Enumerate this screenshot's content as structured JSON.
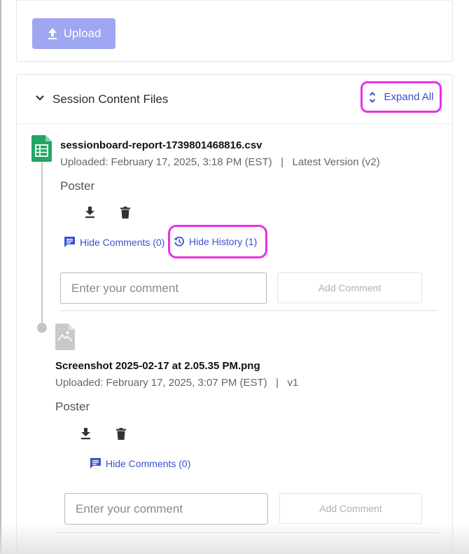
{
  "upload": {
    "label": "Upload",
    "icon": "upload-icon",
    "color": "#9fa6f2"
  },
  "section": {
    "title": "Session Content Files",
    "expand_all_label": "Expand All",
    "accent": "#3d4fd0",
    "highlight_color": "#ee2ee6"
  },
  "files": [
    {
      "name": "sessionboard-report-1739801468816.csv",
      "meta": "Uploaded: February 17, 2025, 3:18 PM (EST)   |   Latest Version (v2)",
      "role": "Poster",
      "file_type_icon": "spreadsheet-icon",
      "comments_label": "Hide Comments (0)",
      "history_label": "Hide History (1)",
      "comment_placeholder": "Enter your comment",
      "add_comment_label": "Add Comment"
    },
    {
      "name": "Screenshot 2025-02-17 at 2.05.35 PM.png",
      "meta": "Uploaded: February 17, 2025, 3:07 PM (EST)   |   v1",
      "role": "Poster",
      "file_type_icon": "image-file-icon",
      "comments_label": "Hide Comments (0)",
      "comment_placeholder": "Enter your comment",
      "add_comment_label": "Add Comment"
    }
  ]
}
